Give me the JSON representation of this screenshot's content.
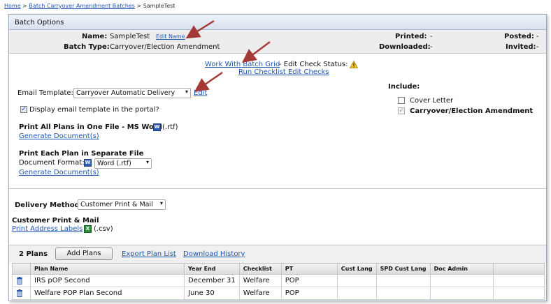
{
  "breadcrumb": {
    "home": "Home",
    "sep": ">",
    "batches": "Batch Carryover Amendment Batches",
    "current": "SampleTest"
  },
  "batch_options": {
    "header": "Batch Options",
    "name_label": "Name:",
    "name_value": "SampleTest",
    "edit_name": "Edit Name",
    "type_label": "Batch Type:",
    "type_value": "Carryover/Election Amendment",
    "printed_label": "Printed:",
    "printed_value": "-",
    "downloaded_label": "Downloaded:",
    "downloaded_value": "-",
    "posted_label": "Posted:",
    "posted_value": "-",
    "invited_label": "Invited:",
    "invited_value": "-"
  },
  "actions": {
    "work_grid": "Work With Batch Grid",
    "edit_check_status": "- Edit Check Status:",
    "run_checklist": "Run Checklist Edit Checks"
  },
  "email": {
    "label": "Email Template:",
    "selected": "Carryover Automatic Delivery",
    "edit": "Edit",
    "display_portal": "Display email template in the portal?"
  },
  "include": {
    "label": "Include:",
    "cover_letter": "Cover Letter",
    "amendment": "Carryover/Election Amendment"
  },
  "print_all": {
    "title": "Print All Plans in One File - MS Word",
    "ext": "(.rtf)",
    "generate": "Generate Document(s)"
  },
  "print_each": {
    "title": "Print Each Plan in Separate File",
    "format_label": "Document Format:",
    "format_selected": "Word (.rtf)",
    "generate": "Generate Document(s)"
  },
  "delivery": {
    "label": "Delivery Method:",
    "selected": "Customer Print & Mail",
    "section_title": "Customer Print & Mail",
    "print_labels": "Print Address Labels",
    "ext": "(.csv)"
  },
  "plans": {
    "count": "2 Plans",
    "add_plans": "Add Plans",
    "export": "Export Plan List",
    "history": "Download History",
    "columns": [
      "Plan Name",
      "Year End",
      "Checklist",
      "PT",
      "Cust Lang",
      "SPD Cust Lang",
      "Doc Admin"
    ],
    "rows": [
      {
        "name": "IRS pOP Second",
        "year_end": "December 31",
        "checklist": "Welfare",
        "pt": "POP",
        "cust_lang": "",
        "spd_cust_lang": "",
        "doc_admin": ""
      },
      {
        "name": "Welfare POP Plan Second",
        "year_end": "June 30",
        "checklist": "Welfare",
        "pt": "POP",
        "cust_lang": "",
        "spd_cust_lang": "",
        "doc_admin": ""
      }
    ]
  },
  "icons": {
    "warning": "warning-icon",
    "word": "word-doc-icon",
    "excel": "excel-icon",
    "trash": "trash-icon"
  },
  "colors": {
    "link": "#1f56b3",
    "annotation_arrow": "#a33a35",
    "header_gradient_top": "#eef3f9",
    "header_gradient_bottom": "#d8e2ee"
  }
}
